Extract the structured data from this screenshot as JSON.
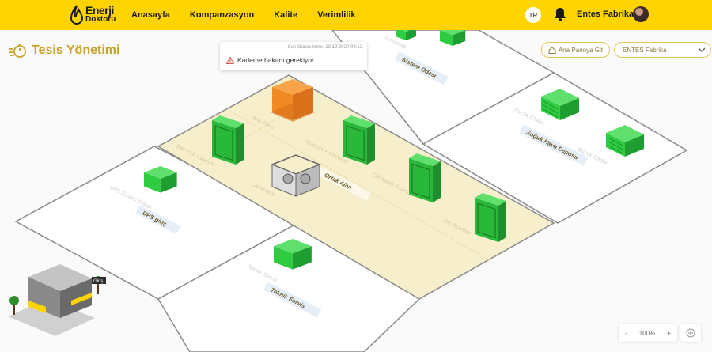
{
  "header": {
    "logo_line1": "Enerji",
    "logo_line2": "Doktoru",
    "nav": [
      "Anasayfa",
      "Kompanzasyon",
      "Kalite",
      "Verimlilik"
    ],
    "lang": "TR",
    "user": "Entes Fabrika"
  },
  "page": {
    "title": "Tesis Yönetimi"
  },
  "alert": {
    "timestamp": "Son Güncelleme: 13.10.2020 09:12",
    "message": "Kademe bakımı gerekiyor"
  },
  "controls": {
    "panel_button": "Ana Panoya Git",
    "facility_select": "ENTES Fabrika",
    "zoom_level": "100%",
    "zoom_out": "-",
    "zoom_in": "+"
  },
  "map": {
    "areas": {
      "ortak": "Ortak Alan",
      "sistem": "Sistem Odası",
      "soguk": "Soğuk Hava Deposu",
      "ups": "UPS giriş",
      "teknik": "Teknik Servis"
    },
    "ghost_labels": {
      "ana_pano": "Ana Pano",
      "asansor_panoramik": "Asansör Panoramik",
      "ban_yuk": "Ban Yük Asansör",
      "jenerator": "Jeneratör",
      "cift_kapili": "Çift Kapılı Asansör",
      "dis_asansor": "Dış Asansör",
      "sunucular": "Sunucular",
      "kucuk_chiller": "Küçük Chiller",
      "buyuk_chiller": "Büyük Chiller",
      "ups_sistem": "UPS Sistem Odası",
      "teknik_servis": "Teknik Servis"
    },
    "building_tag": "Giriş"
  },
  "colors": {
    "header": "#ffd400",
    "accent": "#c9a227",
    "highlight_floor": "#f7efcc",
    "device_green": "#2ecc40",
    "alert_orange": "#f08a24"
  }
}
